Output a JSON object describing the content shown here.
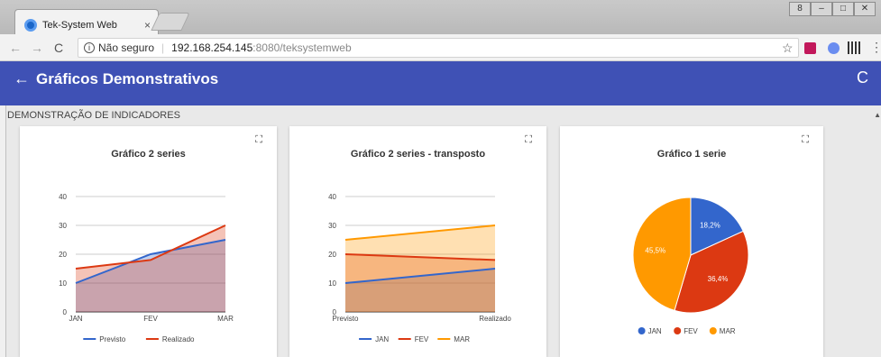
{
  "browser": {
    "tab_title": "Tek-System Web",
    "tab_close": "×",
    "security_label": "Não seguro",
    "url_host": "192.168.254.145",
    "url_rest": ":8080/teksystemweb",
    "win_buttons": [
      "8",
      "–",
      "□",
      "✕"
    ]
  },
  "app": {
    "back_glyph": "←",
    "title": "Gráficos Demonstrativos",
    "refresh_glyph": "C",
    "section_label": "DEMONSTRAÇÃO DE INDICADORES",
    "accent_color": "#3f51b5"
  },
  "cards": [
    {
      "title": "Gráfico 2 series"
    },
    {
      "title": "Gráfico 2 series - transposto"
    },
    {
      "title": "Gráfico 1 serie"
    }
  ],
  "chart_data": [
    {
      "type": "area",
      "title": "Gráfico 2 series",
      "categories": [
        "JAN",
        "FEV",
        "MAR"
      ],
      "ylim": [
        0,
        40
      ],
      "yticks": [
        0,
        10,
        20,
        30,
        40
      ],
      "grid": true,
      "legend_placement": "bottom",
      "series": [
        {
          "name": "Previsto",
          "values": [
            10,
            20,
            25
          ],
          "color": "#3366cc"
        },
        {
          "name": "Realizado",
          "values": [
            15,
            18,
            30
          ],
          "color": "#dc3912"
        }
      ]
    },
    {
      "type": "area",
      "title": "Gráfico 2 series - transposto",
      "categories": [
        "Previsto",
        "Realizado"
      ],
      "ylim": [
        0,
        40
      ],
      "yticks": [
        0,
        10,
        20,
        30,
        40
      ],
      "grid": true,
      "legend_placement": "bottom",
      "series": [
        {
          "name": "JAN",
          "values": [
            10,
            15
          ],
          "color": "#3366cc"
        },
        {
          "name": "FEV",
          "values": [
            20,
            18
          ],
          "color": "#dc3912"
        },
        {
          "name": "MAR",
          "values": [
            25,
            30
          ],
          "color": "#ff9900"
        }
      ]
    },
    {
      "type": "pie",
      "title": "Gráfico 1 serie",
      "legend_placement": "bottom",
      "slices": [
        {
          "label": "JAN",
          "value": 18.2,
          "text": "18,2%",
          "color": "#3366cc"
        },
        {
          "label": "FEV",
          "value": 36.4,
          "text": "36,4%",
          "color": "#dc3912"
        },
        {
          "label": "MAR",
          "value": 45.5,
          "text": "45,5%",
          "color": "#ff9900"
        }
      ]
    }
  ]
}
